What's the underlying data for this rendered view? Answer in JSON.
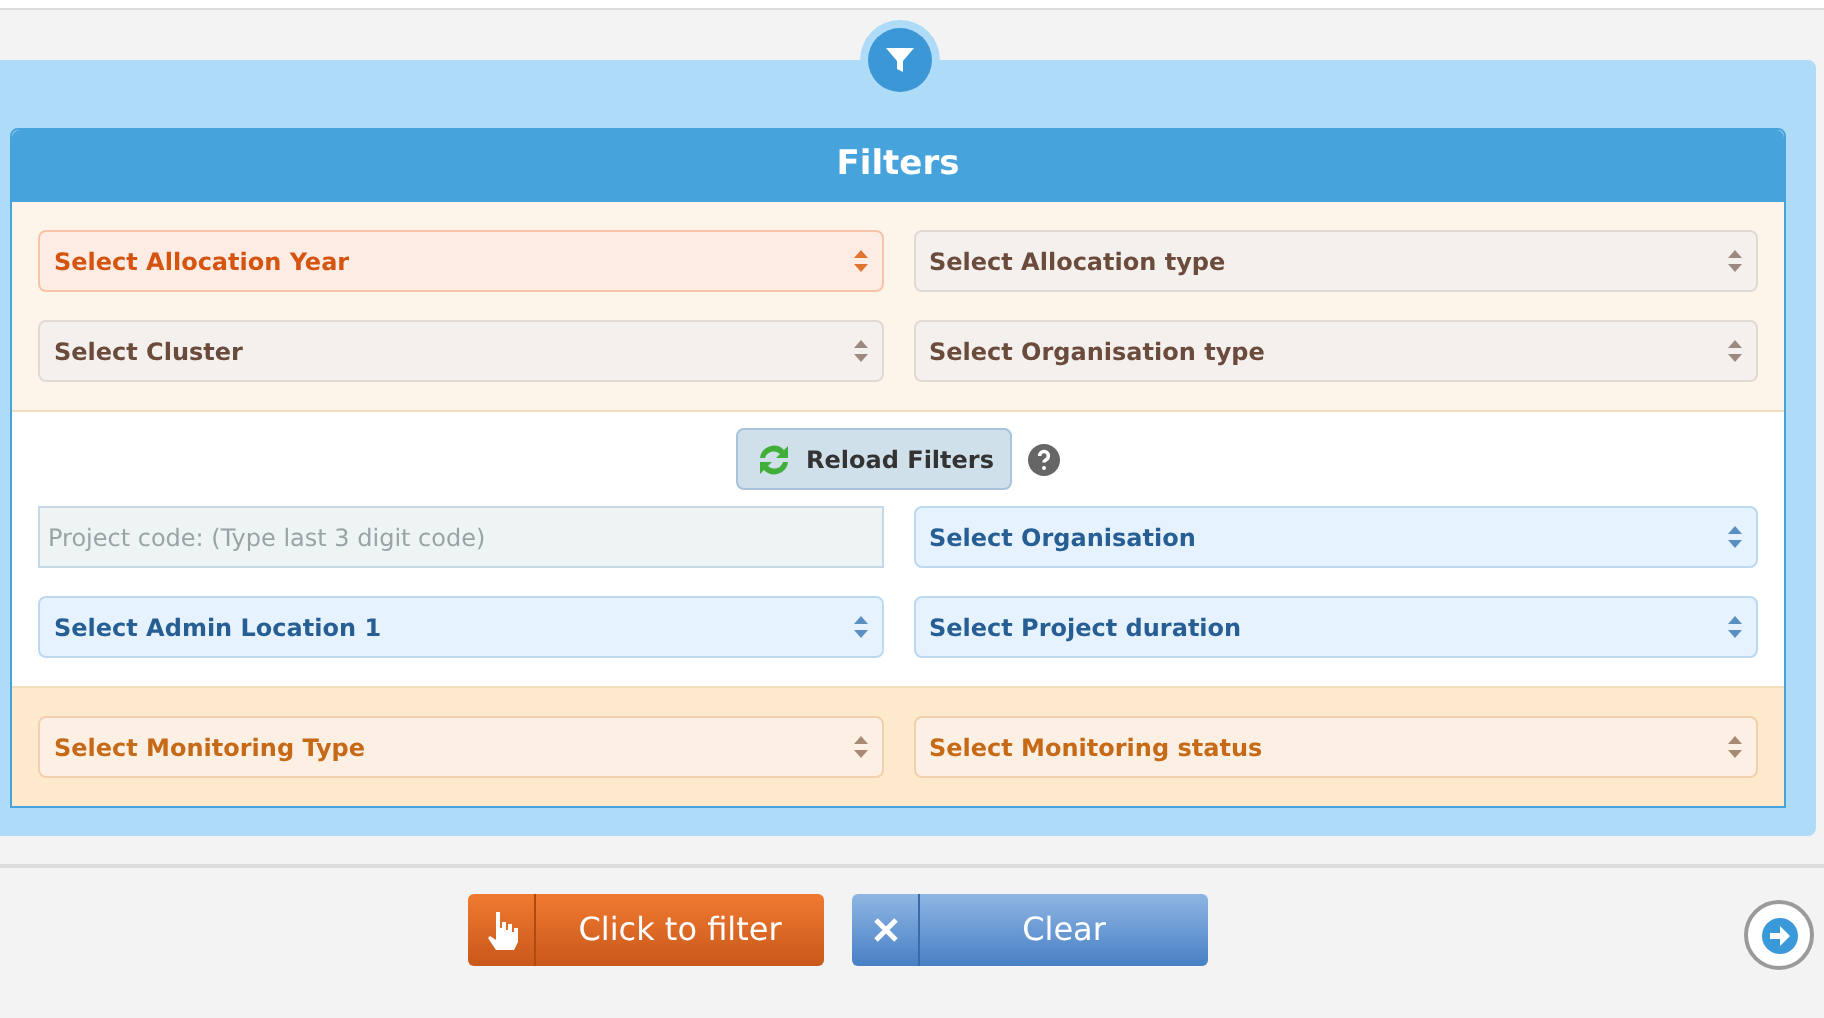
{
  "panel": {
    "title": "Filters"
  },
  "sections": [
    {
      "fields": [
        {
          "kind": "select",
          "label": "Select Allocation Year"
        },
        {
          "kind": "select",
          "label": "Select Allocation type"
        },
        {
          "kind": "select",
          "label": "Select Cluster"
        },
        {
          "kind": "select",
          "label": "Select Organisation type"
        }
      ]
    },
    {
      "reload": {
        "label": "Reload Filters"
      },
      "fields": [
        {
          "kind": "input",
          "placeholder": "Project code: (Type last 3 digit code)"
        },
        {
          "kind": "select",
          "label": "Select Organisation"
        },
        {
          "kind": "select",
          "label": "Select Admin Location 1"
        },
        {
          "kind": "select",
          "label": "Select Project duration"
        }
      ]
    },
    {
      "fields": [
        {
          "kind": "select",
          "label": "Select Monitoring Type"
        },
        {
          "kind": "select",
          "label": "Select Monitoring status"
        }
      ]
    }
  ],
  "actions": {
    "filter": "Click to filter",
    "clear": "Clear"
  }
}
